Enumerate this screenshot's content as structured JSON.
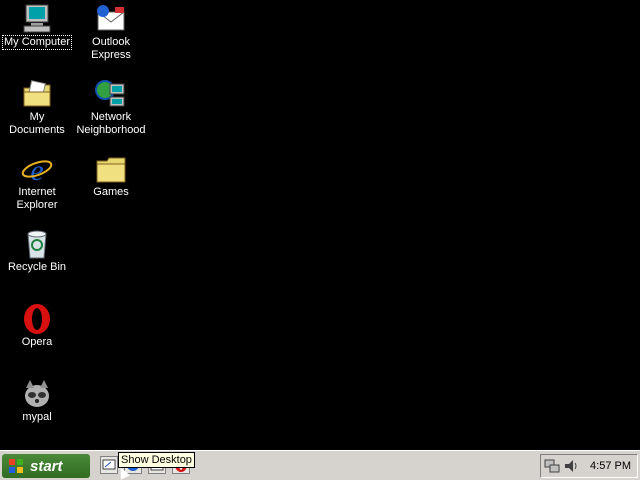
{
  "desktop": {
    "icons": [
      {
        "label": "My Computer",
        "icon": "my-computer-icon"
      },
      {
        "label": "Outlook\nExpress",
        "icon": "outlook-express-icon"
      },
      {
        "label": "My Documents",
        "icon": "my-documents-icon"
      },
      {
        "label": "Network\nNeighborhood",
        "icon": "network-neighborhood-icon"
      },
      {
        "label": "Internet\nExplorer",
        "icon": "internet-explorer-icon"
      },
      {
        "label": "Games",
        "icon": "games-folder-icon"
      },
      {
        "label": "Recycle Bin",
        "icon": "recycle-bin-icon"
      },
      {
        "label": "Opera",
        "icon": "opera-icon"
      },
      {
        "label": "mypal",
        "icon": "mypal-icon"
      }
    ]
  },
  "taskbar": {
    "start_label": "start",
    "tooltip": "Show Desktop",
    "clock": "4:57 PM",
    "quicklaunch": [
      "show-desktop-icon",
      "internet-explorer-icon",
      "outlook-express-icon",
      "opera-icon"
    ],
    "tray": [
      "network-tray-icon",
      "volume-tray-icon"
    ]
  },
  "colors": {
    "desktop_background": "#000000",
    "taskbar": "#d6d3ce",
    "start_button": "#3a7a2c",
    "tooltip_bg": "#ffffe1"
  }
}
